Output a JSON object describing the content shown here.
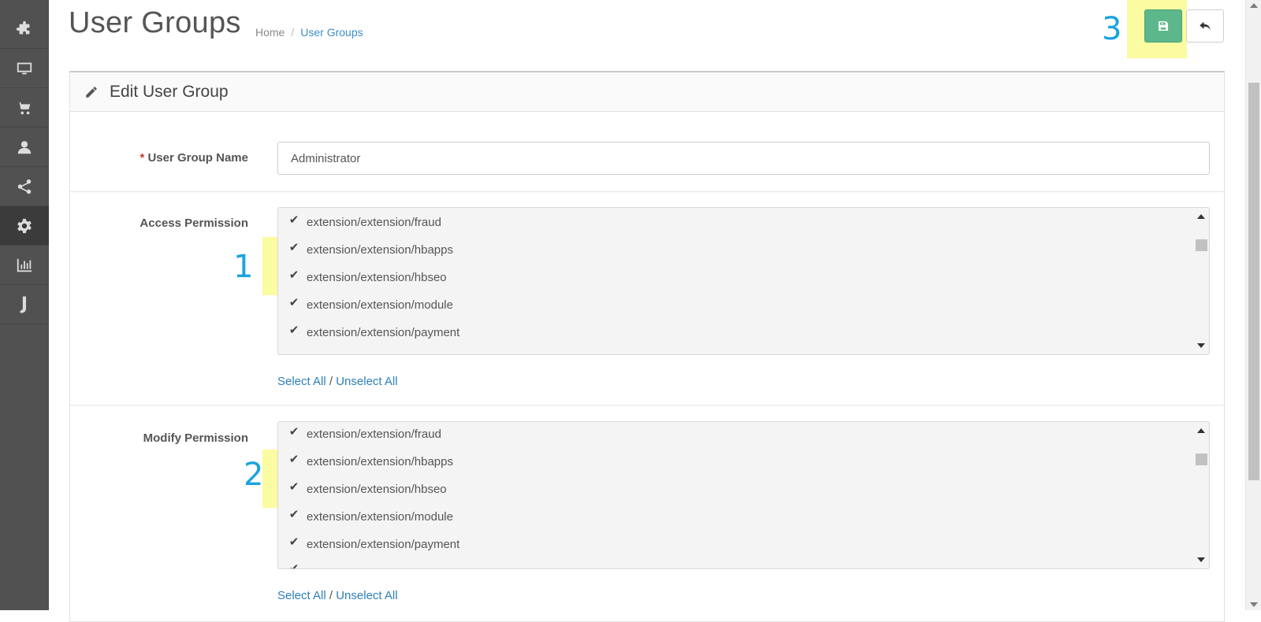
{
  "sidebar": {
    "items": [
      {
        "icon": "puzzle-icon"
      },
      {
        "icon": "desktop-icon"
      },
      {
        "icon": "cart-icon"
      },
      {
        "icon": "user-icon"
      },
      {
        "icon": "share-icon"
      },
      {
        "icon": "gear-icon",
        "active": true
      },
      {
        "icon": "bar-chart-icon"
      },
      {
        "icon": "joomla-icon",
        "letter": "J"
      }
    ]
  },
  "header": {
    "title": "User Groups",
    "breadcrumb": [
      "Home",
      "User Groups"
    ],
    "breadcrumb_sep": "/"
  },
  "annotations": {
    "one": "1",
    "two": "2",
    "three": "3",
    "highlight_color": "#fafa82"
  },
  "panel": {
    "title": "Edit User Group",
    "name_label": "User Group Name",
    "required_mark": "*",
    "name_value": "Administrator",
    "access_label": "Access Permission",
    "modify_label": "Modify Permission",
    "access_items": [
      "extension/extension/fraud",
      "extension/extension/hbapps",
      "extension/extension/hbseo",
      "extension/extension/module",
      "extension/extension/payment"
    ],
    "modify_items": [
      "extension/extension/fraud",
      "extension/extension/hbapps",
      "extension/extension/hbseo",
      "extension/extension/module",
      "extension/extension/payment"
    ],
    "select_all": "Select All",
    "slash": "/",
    "unselect_all": "Unselect All"
  },
  "colors": {
    "save": "#5cb88a",
    "link": "#2d7fb8",
    "annotation": "#1aa3e0"
  }
}
